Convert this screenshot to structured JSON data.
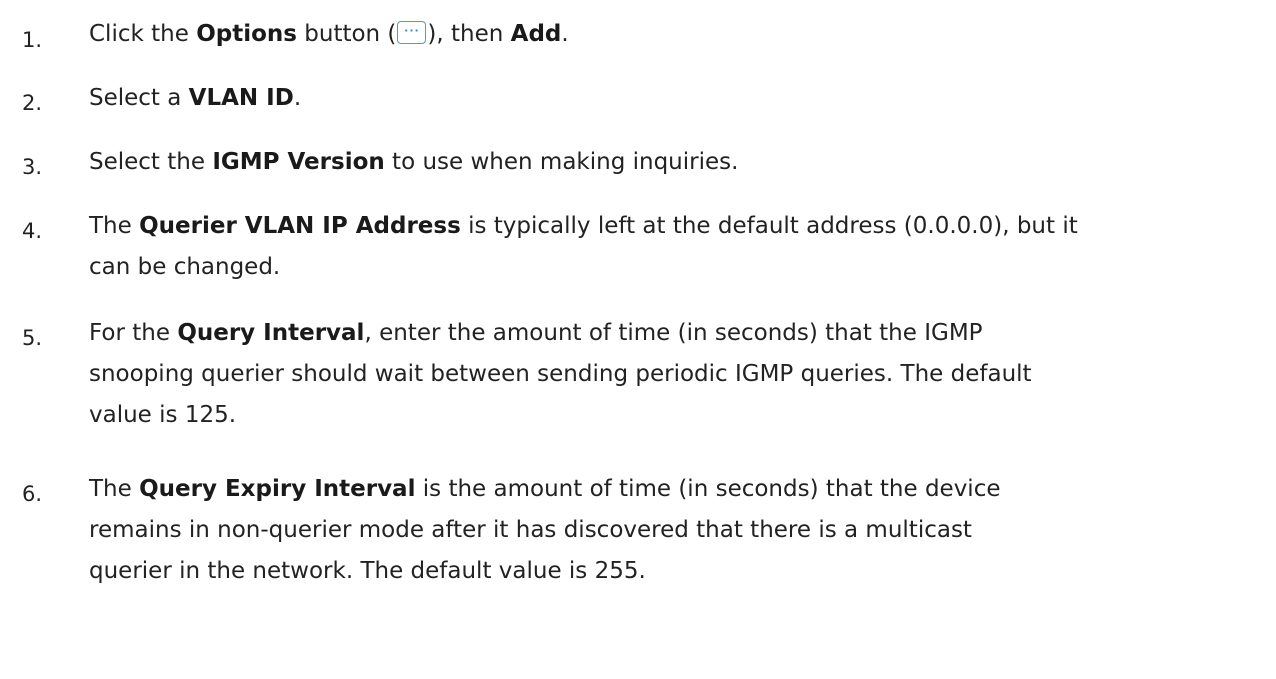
{
  "steps": [
    {
      "number": "1.",
      "pre": "Click the ",
      "bold1": "Options",
      "mid1": " button (",
      "icon": "more-options-icon",
      "mid2": "), then ",
      "bold2": "Add",
      "post": "."
    },
    {
      "number": "2.",
      "pre": "Select a ",
      "bold": "VLAN ID",
      "post": "."
    },
    {
      "number": "3.",
      "pre": "Select the ",
      "bold": "IGMP Version",
      "post": " to use when making inquiries."
    },
    {
      "number": "4.",
      "pre": "The ",
      "bold": "Querier VLAN IP Address",
      "post_lines": [
        " is typically left at the default address (0.0.0.0), but it",
        "can be changed."
      ]
    },
    {
      "number": "5.",
      "pre": "For the ",
      "bold": "Query Interval",
      "post_lines": [
        ", enter the amount of time (in seconds) that the IGMP",
        "snooping querier should wait between sending periodic IGMP queries. The default",
        "value is 125."
      ]
    },
    {
      "number": "6.",
      "pre": "The ",
      "bold": "Query Expiry Interval",
      "post_lines": [
        " is the amount of time (in seconds) that the device",
        "remains in non-querier mode after it has discovered that there is a multicast",
        "querier in the network. The default value is 255."
      ]
    }
  ],
  "icon_dots": "···",
  "colors": {
    "text": "#222222",
    "icon_accent": "#3aa0e8"
  }
}
